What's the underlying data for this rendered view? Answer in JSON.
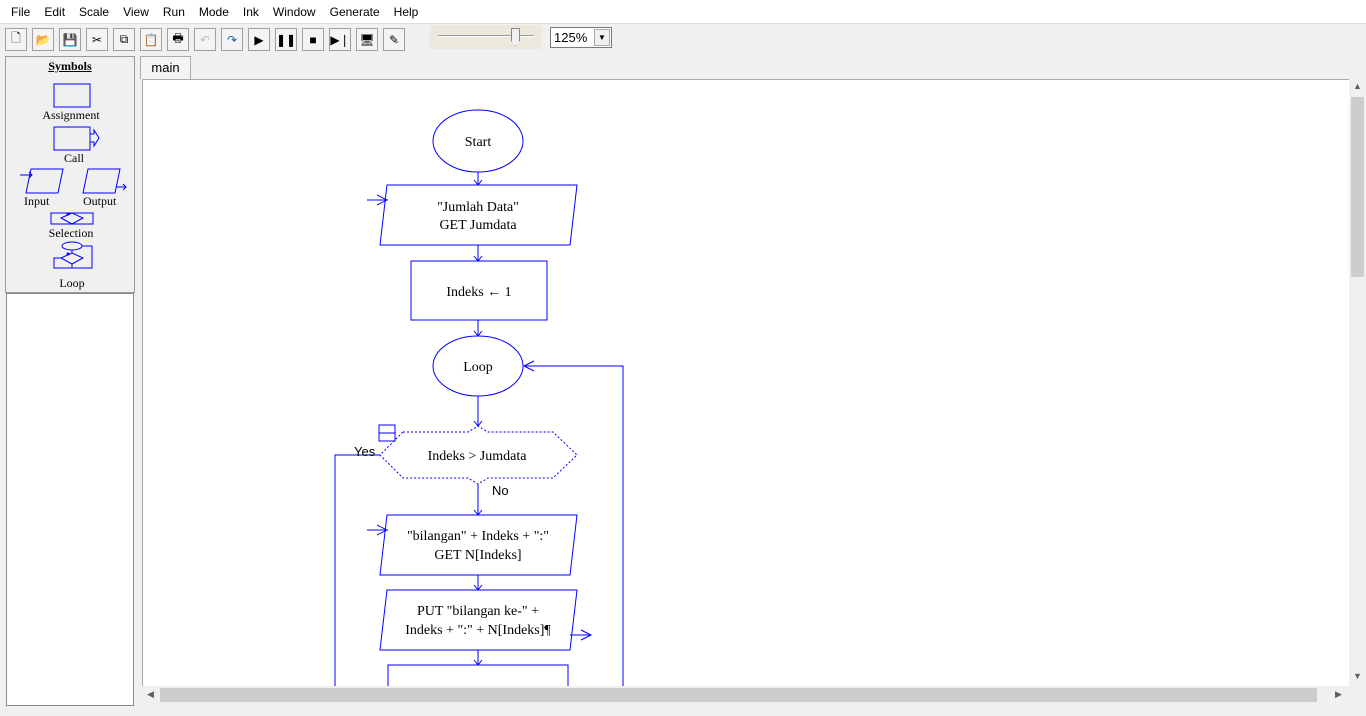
{
  "menu": [
    "File",
    "Edit",
    "Scale",
    "View",
    "Run",
    "Mode",
    "Ink",
    "Window",
    "Generate",
    "Help"
  ],
  "toolbar": {
    "buttons": [
      {
        "name": "new-icon",
        "glyph": "🗋"
      },
      {
        "name": "open-icon",
        "glyph": "📂"
      },
      {
        "name": "save-icon",
        "glyph": "💾"
      },
      {
        "name": "cut-icon",
        "glyph": "✂"
      },
      {
        "name": "copy-icon",
        "glyph": "⧉"
      },
      {
        "name": "paste-icon",
        "glyph": "📋"
      },
      {
        "name": "print-icon",
        "glyph": "🖶"
      },
      {
        "name": "undo-icon",
        "glyph": "↶"
      },
      {
        "name": "redo-icon",
        "glyph": "↷"
      },
      {
        "name": "play-icon",
        "glyph": "▶"
      },
      {
        "name": "pause-icon",
        "glyph": "❚❚"
      },
      {
        "name": "stop-icon",
        "glyph": "■"
      },
      {
        "name": "step-icon",
        "glyph": "▶❘"
      },
      {
        "name": "test-server-icon",
        "glyph": "🖥"
      },
      {
        "name": "pen-icon",
        "glyph": "✎"
      }
    ],
    "zoom": "125%",
    "speed_slider_fraction": 0.8
  },
  "symbols": {
    "title": "Symbols",
    "assignment": "Assignment",
    "call": "Call",
    "input": "Input",
    "output": "Output",
    "selection": "Selection",
    "loop": "Loop"
  },
  "tabs": [
    {
      "label": "main"
    }
  ],
  "flowchart": {
    "start": "Start",
    "input1": [
      "\"Jumlah Data\"",
      "GET Jumdata"
    ],
    "assign1": "Indeks ← 1",
    "loop": "Loop",
    "condition": "Indeks > Jumdata",
    "yes": "Yes",
    "no": "No",
    "input2": [
      "\"bilangan\" + Indeks + \":\"",
      "GET N[Indeks]"
    ],
    "output1": [
      "PUT \"bilangan ke-\" +",
      "Indeks + \":\" + N[Indeks]¶"
    ]
  },
  "colors": {
    "flow": "#0000ff"
  }
}
